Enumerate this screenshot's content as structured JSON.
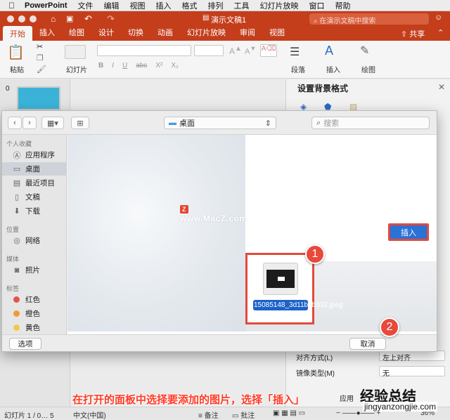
{
  "menubar": {
    "app_name": "PowerPoint",
    "items": [
      "文件",
      "编辑",
      "视图",
      "插入",
      "格式",
      "排列",
      "工具",
      "幻灯片放映",
      "窗口",
      "帮助"
    ]
  },
  "titlebar": {
    "doc_title": "演示文稿1",
    "search_placeholder": "在演示文稿中搜索"
  },
  "ribbon": {
    "tabs": [
      "开始",
      "插入",
      "绘图",
      "设计",
      "切换",
      "动画",
      "幻灯片放映",
      "审阅",
      "视图"
    ],
    "active_tab": "开始",
    "share_label": "共享",
    "paste_label": "粘贴",
    "slides_label": "幻灯片",
    "paragraph_label": "段落",
    "insert_label": "插入",
    "draw_label": "绘图",
    "font_buttons": [
      "B",
      "I",
      "U",
      "abc",
      "X²",
      "X₂"
    ]
  },
  "slide_pane": {
    "slide_number": "0"
  },
  "right_pane": {
    "title": "设置背景格式",
    "align_label": "对齐方式(L)",
    "align_value": "左上对齐",
    "mirror_label": "镜像类型(M)",
    "mirror_value": "无",
    "apply_label": "应用"
  },
  "statusbar": {
    "slide_info": "幻灯片 1 / 0… 5",
    "language": "中文(中国)",
    "notes_label": "备注",
    "comments_label": "批注",
    "zoom": "36%"
  },
  "dialog": {
    "location": "桌面",
    "search_placeholder": "搜索",
    "sidebar": {
      "favorites_header": "个人收藏",
      "favorites": [
        {
          "icon": "applications-icon",
          "label": "应用程序"
        },
        {
          "icon": "desktop-icon",
          "label": "桌面"
        },
        {
          "icon": "recents-icon",
          "label": "最近项目"
        },
        {
          "icon": "documents-icon",
          "label": "文稿"
        },
        {
          "icon": "downloads-icon",
          "label": "下载"
        }
      ],
      "locations_header": "位置",
      "locations": [
        {
          "icon": "network-icon",
          "label": "网络"
        }
      ],
      "media_header": "媒体",
      "media": [
        {
          "icon": "photos-icon",
          "label": "照片"
        }
      ],
      "tags_header": "标签",
      "tags": [
        {
          "label": "红色",
          "color": "#e5534b"
        },
        {
          "label": "橙色",
          "color": "#f19a37"
        },
        {
          "label": "黄色",
          "color": "#f2c94c"
        }
      ]
    },
    "watermark": "www.MacZ.com",
    "file_name": "15085148_3d11b5b332.jpeg",
    "options_button": "选项",
    "cancel_button": "取消",
    "insert_button": "插入"
  },
  "annotations": {
    "badge_1": "1",
    "badge_2": "2",
    "caption": "在打开的面板中选择要添加的图片，选择「插入」",
    "site_logo": "经验总结",
    "site_url": "jingyanzongjie.com"
  },
  "colors": {
    "brand": "#c43e1c",
    "highlight": "#e24a3b",
    "selection": "#1b62c9"
  }
}
